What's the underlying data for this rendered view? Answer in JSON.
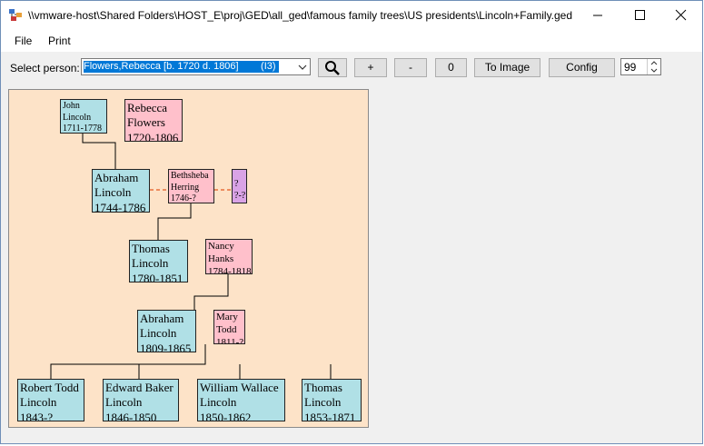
{
  "window": {
    "title": "\\\\vmware-host\\Shared Folders\\HOST_E\\proj\\GED\\all_ged\\famous family trees\\US presidents\\Lincoln+Family.ged",
    "icon": "family-tree-app-icon",
    "controls": [
      "minimize-icon",
      "maximize-icon",
      "close-icon"
    ]
  },
  "menu": {
    "file": "File",
    "print": "Print"
  },
  "toolbar": {
    "select_label": "Select person:",
    "selected_person": "Flowers,Rebecca [b. 1720 d. 1806]        (I3)",
    "search_icon": "magnifier-icon",
    "zoom_in": "+",
    "zoom_out": "-",
    "reset": "0",
    "to_image": "To Image",
    "config": "Config",
    "generations": "99"
  },
  "colors": {
    "male": "#b0e0e6",
    "female": "#ffc0cb",
    "unknown": "#d9a3e6",
    "canvas": "#fde3c8",
    "spouse_link": "#e8703a",
    "selection": "#0078d7"
  },
  "tree": {
    "john": {
      "first": "John",
      "last": "Lincoln",
      "dates": "1711-1778"
    },
    "rebecca": {
      "first": "Rebecca",
      "last": "Flowers",
      "dates": "1720-1806"
    },
    "abraham_sr": {
      "first": "Abraham",
      "last": "Lincoln",
      "dates": "1744-1786"
    },
    "bethsheba": {
      "first": "Bethsheba",
      "last": "Herring",
      "dates": "1746-?"
    },
    "unknown": {
      "first": "?",
      "dates": "?-?"
    },
    "thomas_sr": {
      "first": "Thomas",
      "last": "Lincoln",
      "dates": "1780-1851"
    },
    "nancy": {
      "first": "Nancy",
      "last": "Hanks",
      "dates": "1784-1818"
    },
    "abraham": {
      "first": "Abraham",
      "last": "Lincoln",
      "dates": "1809-1865"
    },
    "mary": {
      "first": "Mary",
      "last": "Todd",
      "dates": "1811-?"
    },
    "children": [
      {
        "first": "Robert Todd",
        "last": "Lincoln",
        "dates": "1843-?"
      },
      {
        "first": "Edward Baker",
        "last": "Lincoln",
        "dates": "1846-1850"
      },
      {
        "first": "William Wallace",
        "last": "Lincoln",
        "dates": "1850-1862"
      },
      {
        "first": "Thomas",
        "last": "Lincoln",
        "dates": "1853-1871"
      }
    ]
  }
}
